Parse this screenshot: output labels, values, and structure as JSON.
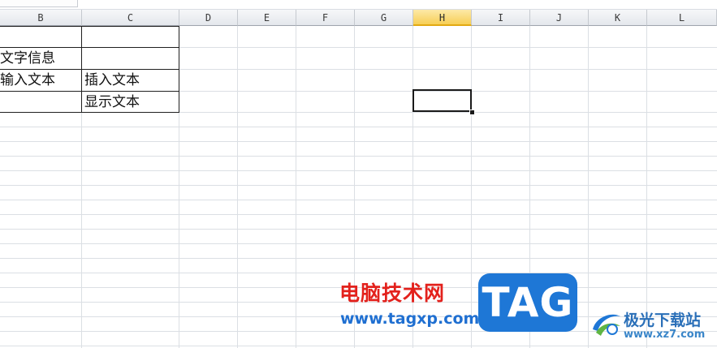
{
  "columns": [
    "B",
    "C",
    "D",
    "E",
    "F",
    "G",
    "H",
    "I",
    "J",
    "K",
    "L"
  ],
  "active_column": "H",
  "cells": {
    "B2": "文字信息",
    "B3": "输入文本",
    "C3": "插入文本",
    "C4": "显示文本"
  },
  "watermark": {
    "site_name": "电脑技术网",
    "site_url": "www.tagxp.com",
    "tag_label": "TAG",
    "logo_text": "极光下载站",
    "logo_url": "www.xz7.com"
  },
  "colors": {
    "active_header": "#f7cf56",
    "gridline": "#dbdfe4",
    "watermark_red": "#e3211c",
    "watermark_blue": "#1e77d6"
  }
}
